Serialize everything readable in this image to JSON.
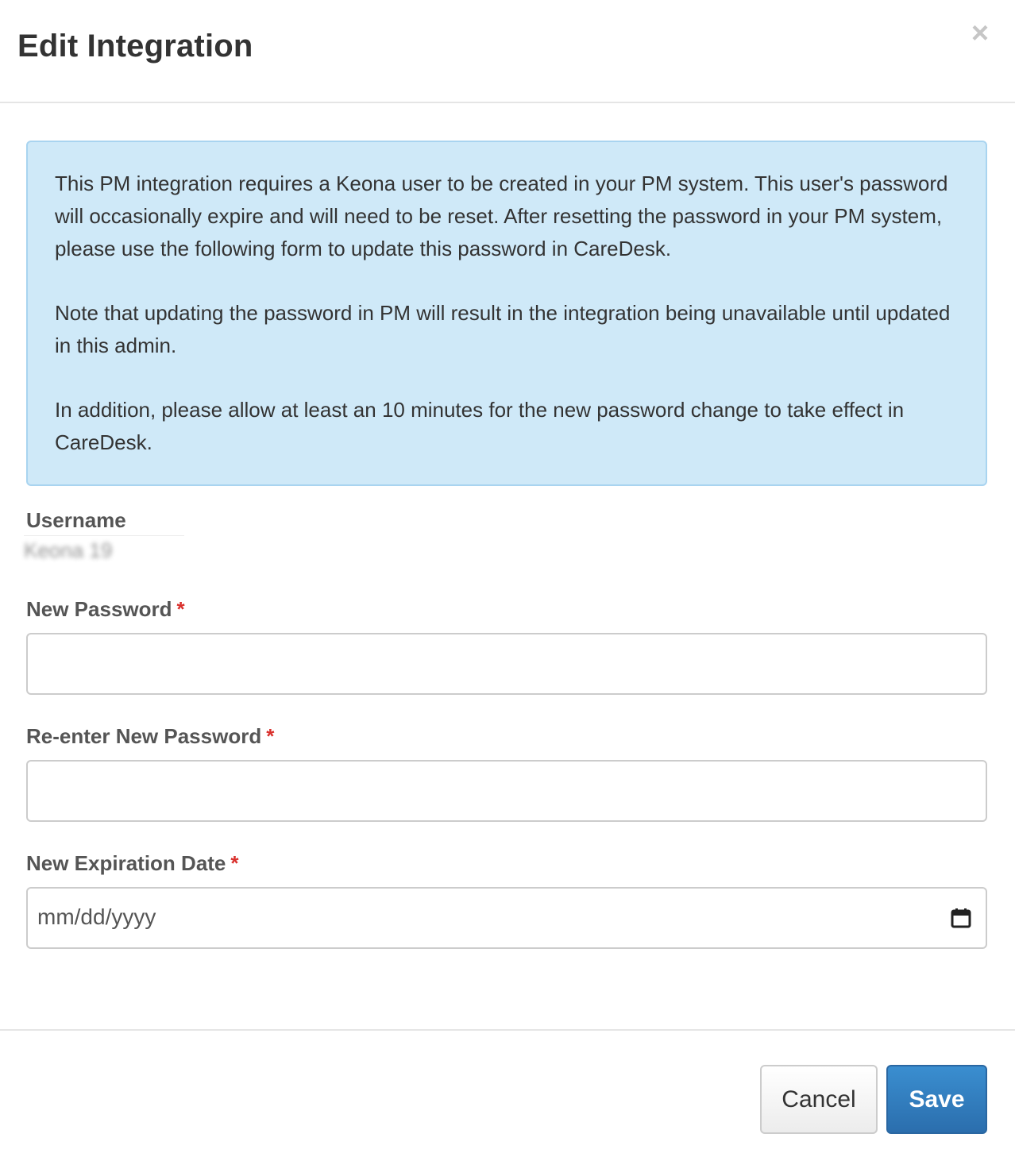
{
  "modal": {
    "title": "Edit Integration",
    "close_glyph": "×"
  },
  "info_alert": {
    "paragraphs": [
      "This PM integration requires a Keona user to be created in your PM system. This user's password will occasionally expire and will need to be reset. After resetting the password in your PM system, please use the following form to update this password in CareDesk.",
      "Note that updating the password in PM will result in the integration being unavailable until updated in this admin.",
      "In addition, please allow at least an 10 minutes for the new password change to take effect in CareDesk."
    ]
  },
  "form": {
    "username": {
      "label": "Username",
      "value": "Keona 19"
    },
    "new_password": {
      "label": "New Password",
      "required_mark": "*",
      "value": ""
    },
    "reenter_password": {
      "label": "Re-enter New Password",
      "required_mark": "*",
      "value": ""
    },
    "expiration_date": {
      "label": "New Expiration Date",
      "required_mark": "*",
      "placeholder": "mm/dd/yyyy",
      "icon": "calendar-icon"
    }
  },
  "footer": {
    "cancel_label": "Cancel",
    "save_label": "Save"
  },
  "colors": {
    "alert_background": "#cfe9f8",
    "alert_border": "#a9d4f0",
    "required_mark": "#d9302c",
    "primary_button": "#2b6ead"
  }
}
